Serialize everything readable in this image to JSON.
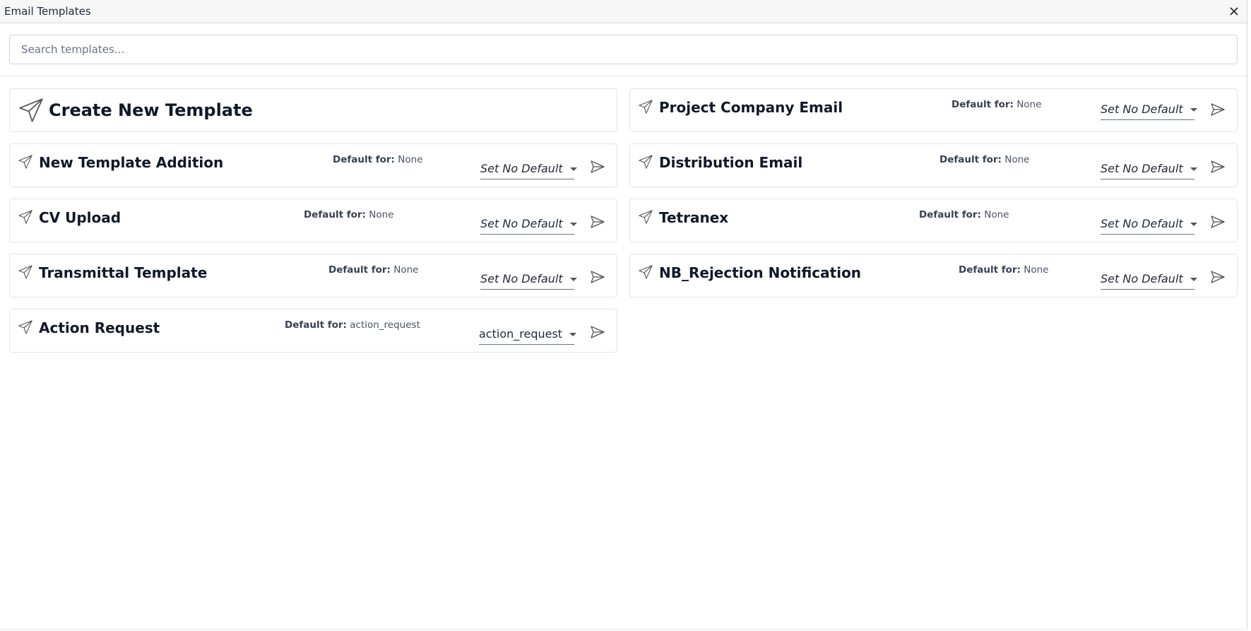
{
  "window": {
    "title": "Email Templates"
  },
  "search": {
    "placeholder": "Search templates..."
  },
  "create": {
    "label": "Create New Template"
  },
  "default_label": "Default for:",
  "templates": [
    {
      "name": "Project Company Email",
      "default_for": "None",
      "select": "Set No Default"
    },
    {
      "name": "New Template Addition",
      "default_for": "None",
      "select": "Set No Default"
    },
    {
      "name": "Distribution Email",
      "default_for": "None",
      "select": "Set No Default"
    },
    {
      "name": "CV Upload",
      "default_for": "None",
      "select": "Set No Default"
    },
    {
      "name": "Tetranex",
      "default_for": "None",
      "select": "Set No Default"
    },
    {
      "name": "Transmittal Template",
      "default_for": "None",
      "select": "Set No Default"
    },
    {
      "name": "NB_Rejection Notification",
      "default_for": "None",
      "select": "Set No Default"
    },
    {
      "name": "Action Request",
      "default_for": "action_request",
      "select": "action_request"
    }
  ],
  "icons": {
    "template": "paper-plane-outline-icon",
    "send": "send-arrow-icon",
    "close": "close-icon"
  }
}
